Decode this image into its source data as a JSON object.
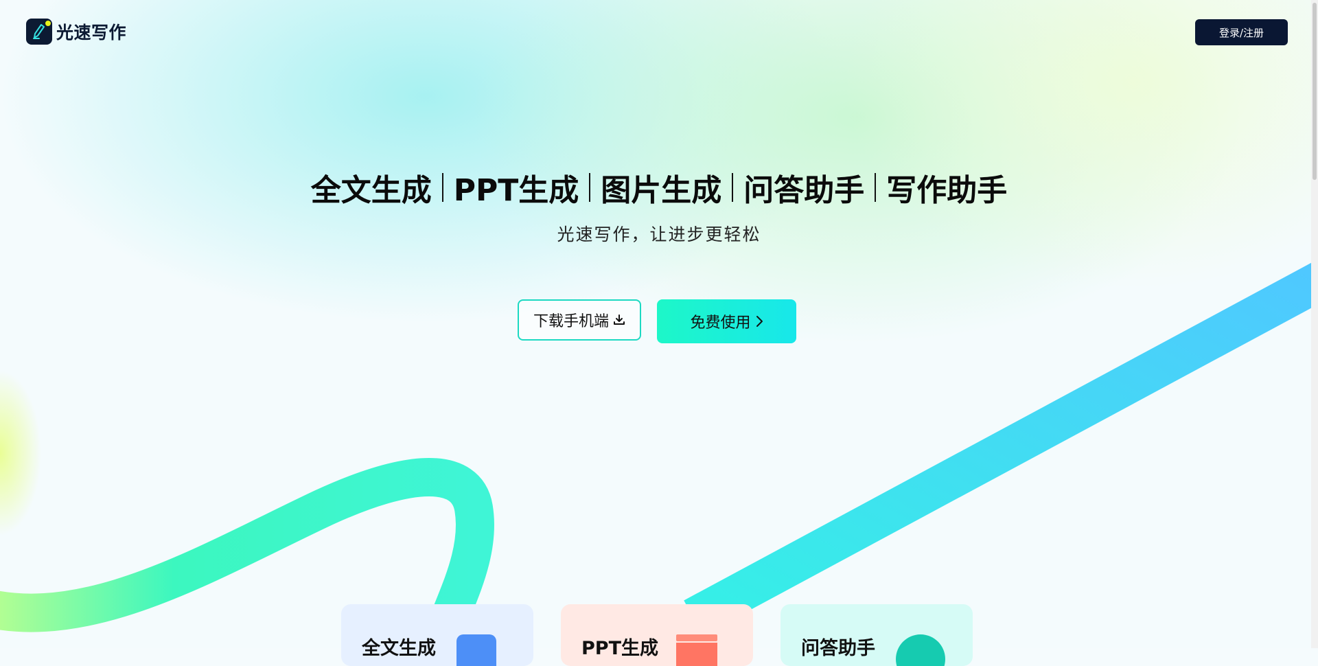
{
  "header": {
    "logo_text": "光速写作",
    "login_label": "登录/注册"
  },
  "hero": {
    "titles": [
      "全文生成",
      "PPT生成",
      "图片生成",
      "问答助手",
      "写作助手"
    ],
    "subtitle": "光速写作，让进步更轻松",
    "download_label": "下载手机端",
    "free_label": "免费使用"
  },
  "features": [
    {
      "label": "全文生成",
      "icon": "document-icon"
    },
    {
      "label": "PPT生成",
      "icon": "presentation-icon"
    },
    {
      "label": "问答助手",
      "icon": "chat-icon"
    }
  ],
  "colors": {
    "brand_dark": "#0a1733",
    "accent_teal": "#1df7c8",
    "accent_cyan": "#18e7ea",
    "ribbon_blue": "#4fcbff",
    "ribbon_green": "#36f5c7"
  }
}
